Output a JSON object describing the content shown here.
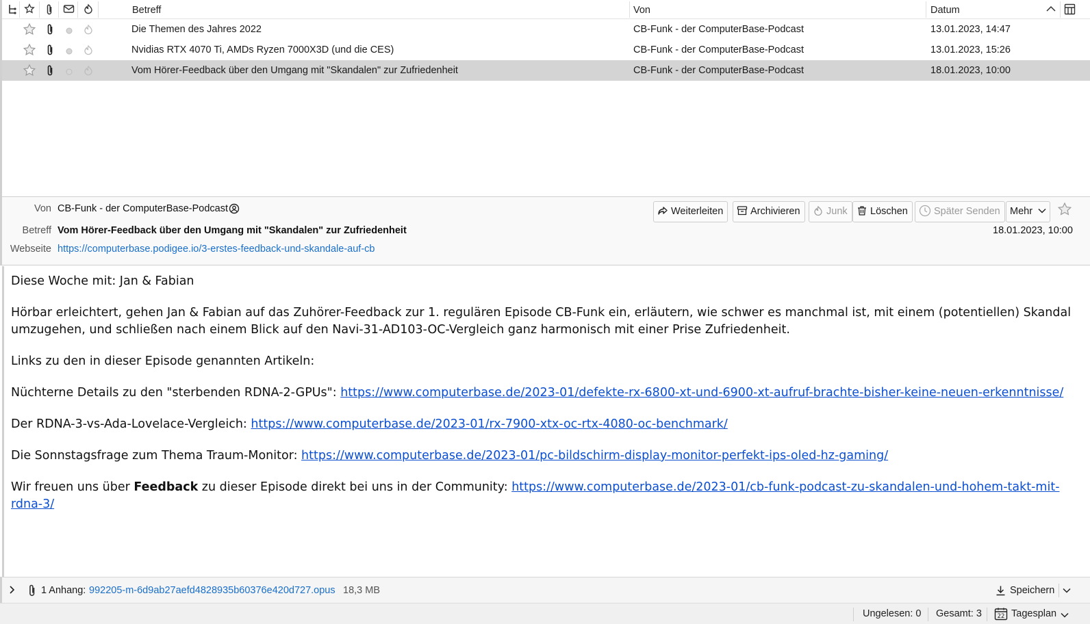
{
  "columns": {
    "subject": "Betreff",
    "from": "Von",
    "date": "Datum"
  },
  "messages": [
    {
      "subject": "Die Themen des Jahres 2022",
      "from": "CB-Funk - der ComputerBase-Podcast",
      "date": "13.01.2023, 14:47",
      "selected": false
    },
    {
      "subject": "Nvidias RTX 4070 Ti, AMDs Ryzen 7000X3D (und die CES)",
      "from": "CB-Funk - der ComputerBase-Podcast",
      "date": "13.01.2023, 15:26",
      "selected": false
    },
    {
      "subject": "Vom Hörer-Feedback über den Umgang mit \"Skandalen\" zur Zufriedenheit",
      "from": "CB-Funk - der ComputerBase-Podcast",
      "date": "18.01.2023, 10:00",
      "selected": true
    }
  ],
  "header": {
    "from_label": "Von",
    "from_value": "CB-Funk - der ComputerBase-Podcast",
    "subject_label": "Betreff",
    "subject_value": "Vom Hörer-Feedback über den Umgang mit \"Skandalen\" zur Zufriedenheit",
    "website_label": "Webseite",
    "website_value": "https://computerbase.podigee.io/3-erstes-feedback-und-skandale-auf-cb",
    "date": "18.01.2023, 10:00",
    "buttons": {
      "forward": "Weiterleiten",
      "archive": "Archivieren",
      "junk": "Junk",
      "delete": "Löschen",
      "send_later": "Später Senden",
      "more": "Mehr"
    }
  },
  "body": {
    "intro": "Diese Woche mit: Jan & Fabian",
    "paragraph": "Hörbar erleichtert, gehen Jan & Fabian auf das Zuhörer-Feedback zur 1. regulären Episode CB-Funk ein, erläutern, wie schwer es manchmal ist, mit einem (potentiellen) Skandal umzugehen, und schließen nach einem Blick auf den Navi-31-AD103-OC-Vergleich ganz harmonisch mit einer Prise Zufriedenheit.",
    "links_heading": "Links zu den in dieser Episode genannten Artikeln:",
    "link1_text": "Nüchterne Details zu den \"sterbenden RDNA-2-GPUs\": ",
    "link1_url": "https://www.computerbase.de/2023-01/defekte-rx-6800-xt-und-6900-xt-aufruf-brachte-bisher-keine-neuen-erkenntnisse/",
    "link2_text": "Der RDNA-3-vs-Ada-Lovelace-Vergleich: ",
    "link2_url": "https://www.computerbase.de/2023-01/rx-7900-xtx-oc-rtx-4080-oc-benchmark/",
    "link3_text": "Die Sonnstagsfrage zum Thema Traum-Monitor: ",
    "link3_url": "https://www.computerbase.de/2023-01/pc-bildschirm-display-monitor-perfekt-ips-oled-hz-gaming/",
    "feedback_pre": "Wir freuen uns über ",
    "feedback_bold": "Feedback",
    "feedback_post": " zu dieser Episode direkt bei uns in der Community: ",
    "feedback_url": "https://www.computerbase.de/2023-01/cb-funk-podcast-zu-skandalen-und-hohem-takt-mit-rdna-3/"
  },
  "attachment": {
    "label": "1 Anhang:",
    "filename": "992205-m-6d9ab27aefd4828935b60376e420d727.opus",
    "size": "18,3 MB",
    "save": "Speichern"
  },
  "status": {
    "unread": "Ungelesen: 0",
    "total": "Gesamt: 3",
    "calendar_day": "22",
    "agenda": "Tagesplan"
  },
  "colors": {
    "link": "#1a6fc9",
    "body_link": "#0b4fd0",
    "selected_row": "#d4d4d4"
  }
}
